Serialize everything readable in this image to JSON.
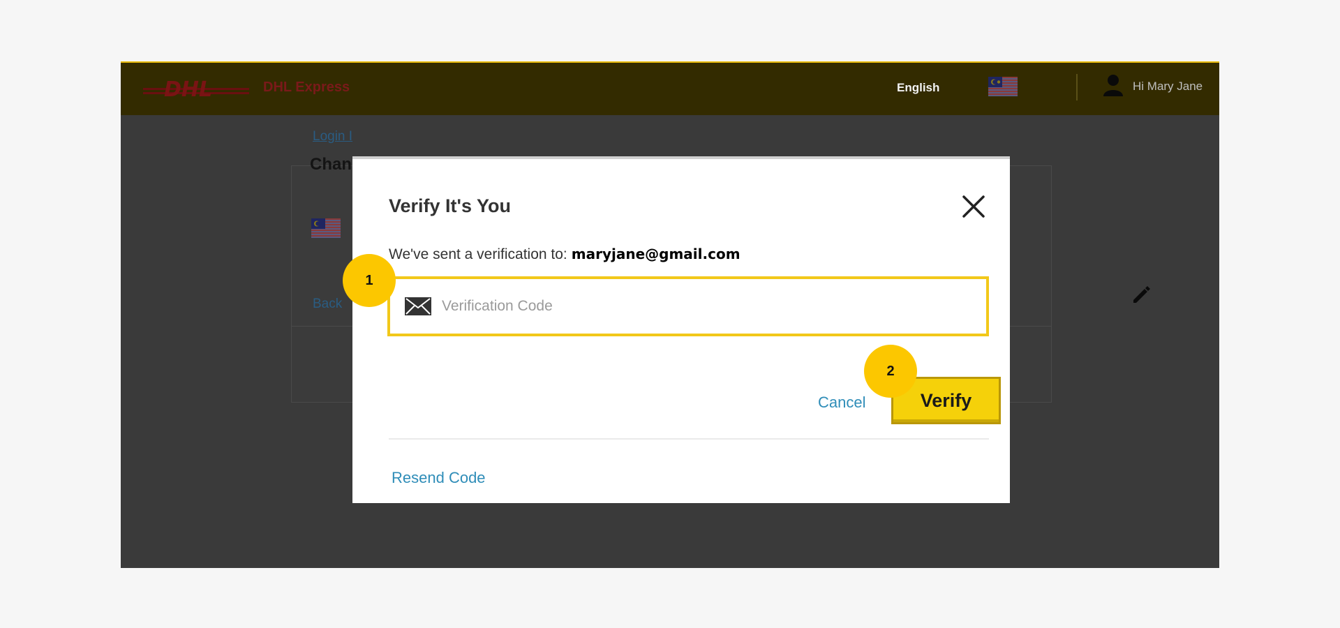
{
  "header": {
    "brand_text": "DHL Express",
    "language": "English",
    "greeting": "Hi Mary Jane"
  },
  "background": {
    "breadcrumb_link": "Login I",
    "section_title": "Chan",
    "back_link": "Back"
  },
  "modal": {
    "title": "Verify It's You",
    "sent_label": "We've sent a verification to:",
    "sent_email": "maryjane@gmail.com",
    "code_placeholder": "Verification Code",
    "code_value": "",
    "cancel_label": "Cancel",
    "verify_label": "Verify",
    "resend_label": "Resend Code"
  },
  "badges": {
    "step1": "1",
    "step2": "2"
  },
  "colors": {
    "dhl_yellow": "#ffcc00",
    "dhl_red": "#d40511",
    "accent_link": "#2f8db8",
    "badge": "#fcc700"
  }
}
